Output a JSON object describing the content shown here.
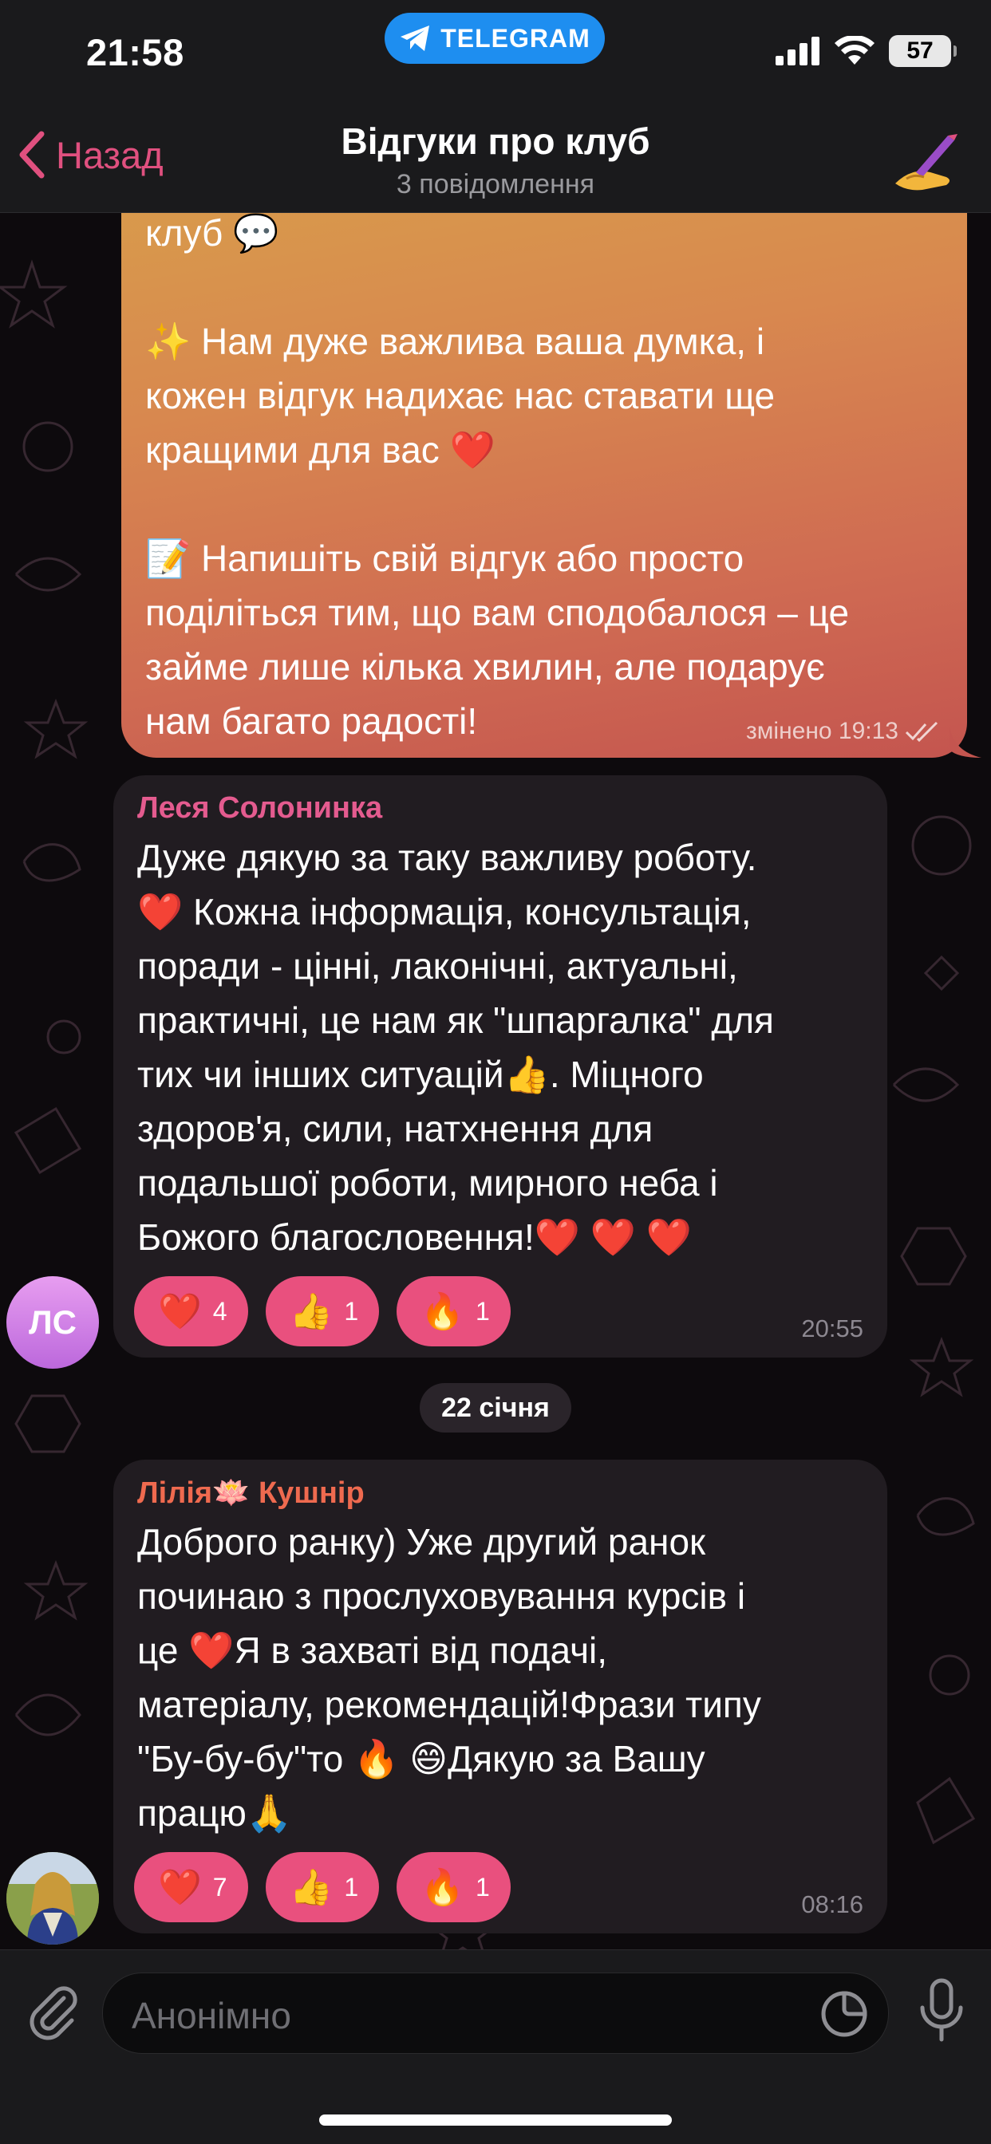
{
  "status_bar": {
    "time": "21:58",
    "telegram_label": "TELEGRAM",
    "battery": "57"
  },
  "header": {
    "back_label": "Назад",
    "title": "Відгуки про клуб",
    "subtitle": "3 повідомлення"
  },
  "outgoing_message": {
    "lines": [
      "клуб 💬",
      "",
      "✨ Нам дуже важлива ваша думка, і",
      "кожен відгук надихає нас ставати ще",
      "кращими для вас ❤️",
      "",
      "📝 Напишіть свій відгук або просто",
      "поділіться тим, що вам сподобалося – це",
      "займе лише кілька хвилин, але подарує",
      "нам багато радості!"
    ],
    "edit_meta": "змінено 19:13"
  },
  "messages": [
    {
      "sender": "Леся Солонинка",
      "sender_color": "#e45b8f",
      "avatar_initials": "ЛС",
      "lines": [
        "Дуже дякую за таку важливу роботу.",
        "❤️ Кожна інформація, консультація,",
        "поради - цінні, лаконічні, актуальні,",
        "практичні, це нам як \"шпаргалка\" для",
        "тих чи інших ситуацій👍. Міцного",
        "здоров'я, сили, натхнення для",
        "подальшої роботи, мирного неба і",
        "Божого благословення!❤️ ❤️ ❤️"
      ],
      "reactions": [
        {
          "emoji": "❤️",
          "count": "4"
        },
        {
          "emoji": "👍",
          "count": "1"
        },
        {
          "emoji": "🔥",
          "count": "1"
        }
      ],
      "time": "20:55"
    },
    {
      "sender": "Лілія🪷 Кушнір",
      "sender_color": "#ef6a4f",
      "lines": [
        "Доброго ранку) Уже другий ранок",
        "починаю з прослуховування курсів і",
        "це ❤️Я в захваті від подачі,",
        "матеріалу, рекомендацій!Фрази типу",
        "\"Бу-бу-бу\"то 🔥 😄Дякую за Вашу",
        "працю🙏"
      ],
      "reactions": [
        {
          "emoji": "❤️",
          "count": "7"
        },
        {
          "emoji": "👍",
          "count": "1"
        },
        {
          "emoji": "🔥",
          "count": "1"
        }
      ],
      "time": "08:16"
    }
  ],
  "date_separator": "22 січня",
  "input": {
    "placeholder": "Анонімно"
  },
  "colors": {
    "accent": "#e0507f",
    "reaction_pill": "#e9507e",
    "incoming_bubble": "#211c21",
    "telegram_blue": "#1e8ef0"
  },
  "icons": [
    "back-chevron-icon",
    "telegram-plane-icon",
    "signal-icon",
    "wifi-icon",
    "battery-icon",
    "paperclip-icon",
    "sticker-icon",
    "microphone-icon",
    "double-check-icon"
  ]
}
